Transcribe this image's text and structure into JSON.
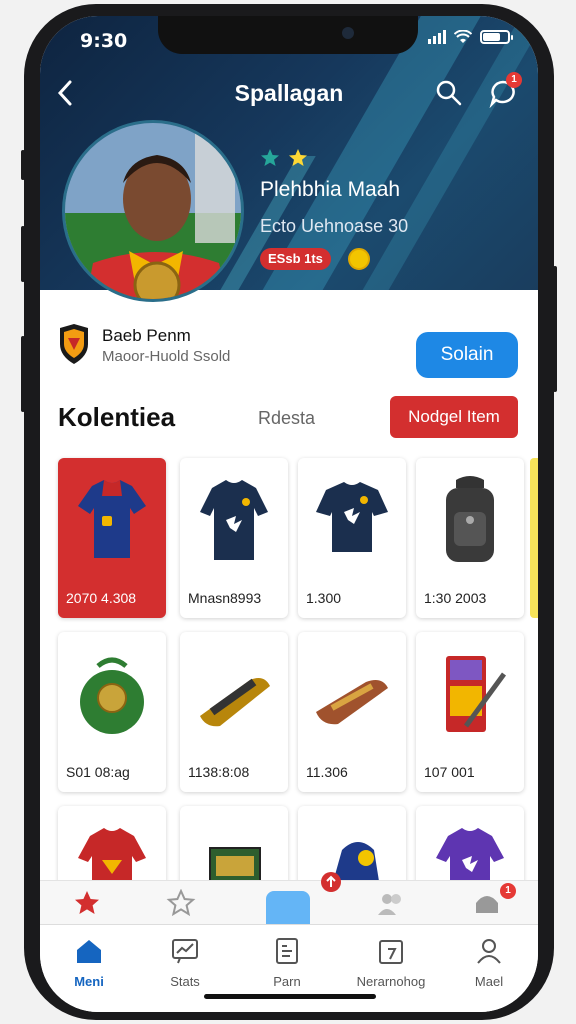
{
  "status": {
    "time": "9:30"
  },
  "header": {
    "title": "Spallagan",
    "notification_count": "1"
  },
  "player": {
    "name": "Plehbhia Maah",
    "subtitle": "Ecto Uehnoase 30",
    "tag": "ESsb 1ts"
  },
  "club": {
    "name": "Baeb Penm",
    "subtitle": "Maoor-Huold Ssold",
    "action_label": "Solain"
  },
  "collection": {
    "title": "Kolentiea",
    "link_label": "Rdesta",
    "add_label": "Nodgel Item",
    "items": [
      {
        "name": "red-jersey",
        "price": "2070 4.308"
      },
      {
        "name": "navy-jersey",
        "price": "Mnasn8993"
      },
      {
        "name": "navy-shirt",
        "price": "1.300"
      },
      {
        "name": "backpack",
        "price": "1:30 2003"
      },
      {
        "name": "green-ball",
        "price": "S01 08:ag"
      },
      {
        "name": "gold-boot",
        "price": "1138:8:08"
      },
      {
        "name": "brown-boot",
        "price": "11.306"
      },
      {
        "name": "card-pack",
        "price": "107 001"
      },
      {
        "name": "red-jersey-2",
        "price": ""
      },
      {
        "name": "green-box",
        "price": ""
      },
      {
        "name": "blue-bag",
        "price": ""
      },
      {
        "name": "purple-jersey",
        "price": ""
      }
    ]
  },
  "subtabs": {
    "badge_right": "1"
  },
  "tabbar": {
    "items": [
      {
        "label": "Meni",
        "icon": "home-icon"
      },
      {
        "label": "Stats",
        "icon": "chart-icon"
      },
      {
        "label": "Parn",
        "icon": "document-icon"
      },
      {
        "label": "Nerarnohog",
        "icon": "calendar-icon"
      },
      {
        "label": "Mael",
        "icon": "profile-icon"
      }
    ]
  },
  "colors": {
    "accent_red": "#d32f2f",
    "accent_blue": "#1e88e5",
    "hero_dark": "#0e2440"
  }
}
